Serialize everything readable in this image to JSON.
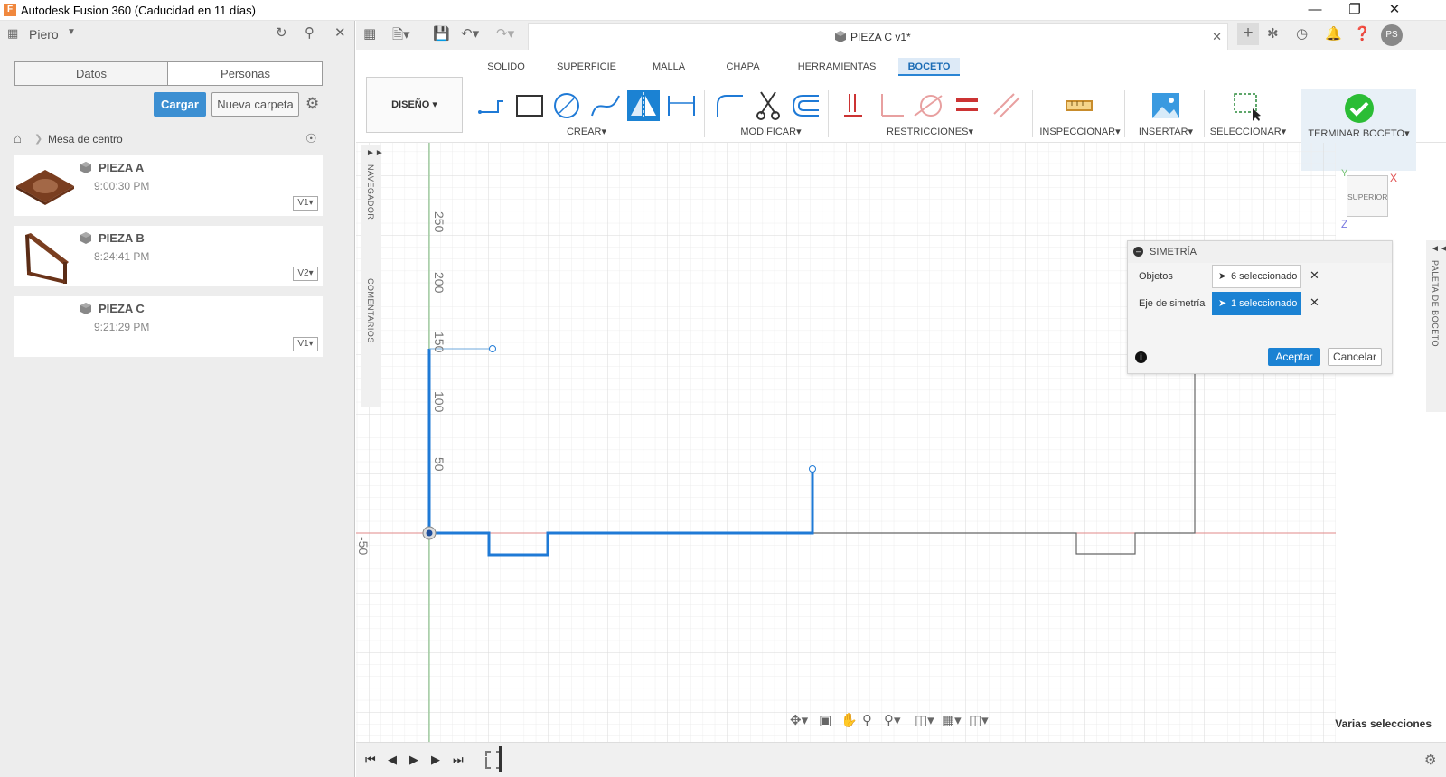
{
  "window": {
    "title": "Autodesk Fusion 360 (Caducidad en 11 días)",
    "controls": [
      "minimize-icon",
      "restore-icon",
      "close-icon"
    ]
  },
  "data_panel": {
    "user": "Piero",
    "tabs": [
      {
        "label": "Datos",
        "active": true
      },
      {
        "label": "Personas",
        "active": false
      }
    ],
    "upload_label": "Cargar",
    "new_folder_label": "Nueva carpeta",
    "breadcrumb": "Mesa de centro",
    "items": [
      {
        "name": "PIEZA A",
        "time": "9:00:30 PM",
        "version": "V1"
      },
      {
        "name": "PIEZA B",
        "time": "8:24:41 PM",
        "version": "V2"
      },
      {
        "name": "PIEZA C",
        "time": "9:21:29 PM",
        "version": "V1"
      }
    ]
  },
  "document": {
    "tab_title": "PIEZA C v1*",
    "profile_initials": "PS"
  },
  "toolbar": {
    "workspace": "DISEÑO",
    "tabs": [
      {
        "label": "SOLIDO",
        "active": false
      },
      {
        "label": "SUPERFICIE",
        "active": false
      },
      {
        "label": "MALLA",
        "active": false
      },
      {
        "label": "CHAPA",
        "active": false
      },
      {
        "label": "HERRAMIENTAS",
        "active": false
      },
      {
        "label": "BOCETO",
        "active": true
      }
    ],
    "groups": {
      "create": "CREAR",
      "modify": "MODIFICAR",
      "constraints": "RESTRICCIONES",
      "inspect": "INSPECCIONAR",
      "insert": "INSERTAR",
      "select": "SELECCIONAR",
      "finish": "TERMINAR BOCETO"
    }
  },
  "side_panels": {
    "navigator": "NAVEGADOR",
    "comments": "COMENTARIOS",
    "sketch_palette": "PALETA DE BOCETO"
  },
  "viewcube": {
    "face": "SUPERIOR",
    "x": "X",
    "y": "Y",
    "z": "Z"
  },
  "axis_labels": {
    "y": [
      "250",
      "200",
      "150",
      "100",
      "50"
    ],
    "neg": "-50"
  },
  "symmetry_dialog": {
    "title": "SIMETRÍA",
    "objects_label": "Objetos",
    "objects_value": "6 seleccionado",
    "axis_label": "Eje de simetría",
    "axis_value": "1 seleccionado",
    "ok": "Aceptar",
    "cancel": "Cancelar"
  },
  "status": "Varias selecciones",
  "colors": {
    "accent": "#1b82d3",
    "sketch_line": "#1f7ad6",
    "axis_red": "#e07a7a",
    "axis_green": "#6fbf6f",
    "grid": "#e6e6e6",
    "finish_green": "#2bbd35"
  }
}
